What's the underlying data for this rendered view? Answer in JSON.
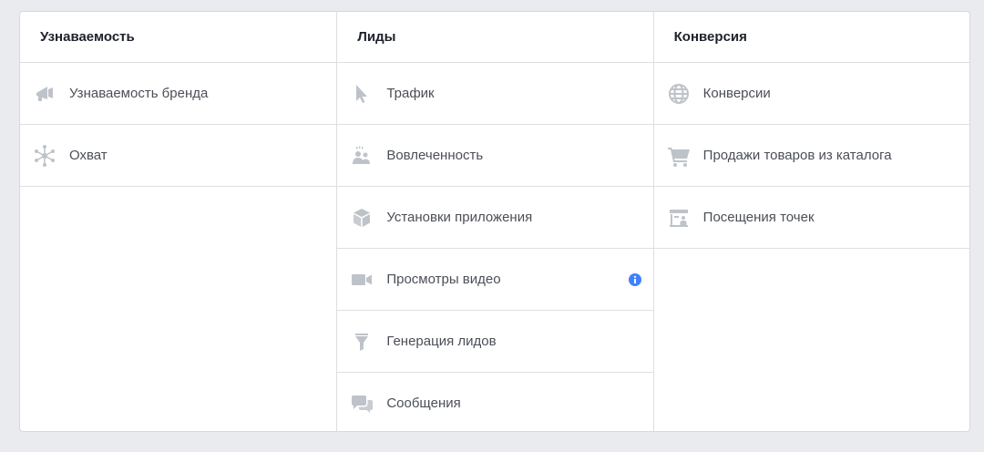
{
  "columns": [
    {
      "title": "Узнаваемость",
      "items": [
        {
          "label": "Узнаваемость бренда",
          "icon": "megaphone-icon"
        },
        {
          "label": "Охват",
          "icon": "reach-icon"
        }
      ]
    },
    {
      "title": "Лиды",
      "items": [
        {
          "label": "Трафик",
          "icon": "cursor-icon"
        },
        {
          "label": "Вовлеченность",
          "icon": "people-icon"
        },
        {
          "label": "Установки приложения",
          "icon": "box-icon"
        },
        {
          "label": "Просмотры видео",
          "icon": "video-camera-icon",
          "info": true
        },
        {
          "label": "Генерация лидов",
          "icon": "funnel-icon"
        },
        {
          "label": "Сообщения",
          "icon": "chat-bubbles-icon"
        }
      ]
    },
    {
      "title": "Конверсия",
      "items": [
        {
          "label": "Конверсии",
          "icon": "globe-icon"
        },
        {
          "label": "Продажи товаров из каталога",
          "icon": "shopping-cart-icon"
        },
        {
          "label": "Посещения точек",
          "icon": "storefront-icon"
        }
      ]
    }
  ],
  "colors": {
    "icon": "#bec3c9",
    "info": "#4080ff",
    "text": "#4b4f56",
    "header": "#1d2129",
    "border": "#dddfe2"
  }
}
